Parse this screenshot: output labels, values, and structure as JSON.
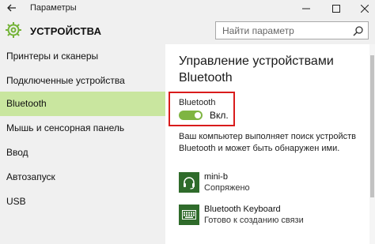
{
  "window": {
    "title": "Параметры"
  },
  "header": {
    "title": "УСТРОЙСТВА",
    "search_placeholder": "Найти параметр"
  },
  "sidebar": {
    "items": [
      {
        "label": "Принтеры и сканеры",
        "selected": false
      },
      {
        "label": "Подключенные устройства",
        "selected": false
      },
      {
        "label": "Bluetooth",
        "selected": true
      },
      {
        "label": "Мышь и сенсорная панель",
        "selected": false
      },
      {
        "label": "Ввод",
        "selected": false
      },
      {
        "label": "Автозапуск",
        "selected": false
      },
      {
        "label": "USB",
        "selected": false
      }
    ]
  },
  "main": {
    "title": "Управление устройствами Bluetooth",
    "bluetooth_label": "Bluetooth",
    "toggle_state": "Вкл.",
    "toggle_on": true,
    "description": "Ваш компьютер выполняет поиск устройств Bluetooth и может быть обнаружен ими.",
    "devices": [
      {
        "name": "mini-b",
        "status": "Сопряжено",
        "icon": "headset-icon"
      },
      {
        "name": "Bluetooth Keyboard",
        "status": "Готово к созданию связи",
        "icon": "keyboard-icon"
      }
    ]
  },
  "colors": {
    "accent": "#7fb542",
    "selected_nav": "#c9e69f",
    "highlight_box": "#d91c1c",
    "device_tile": "#2f6b2b"
  }
}
